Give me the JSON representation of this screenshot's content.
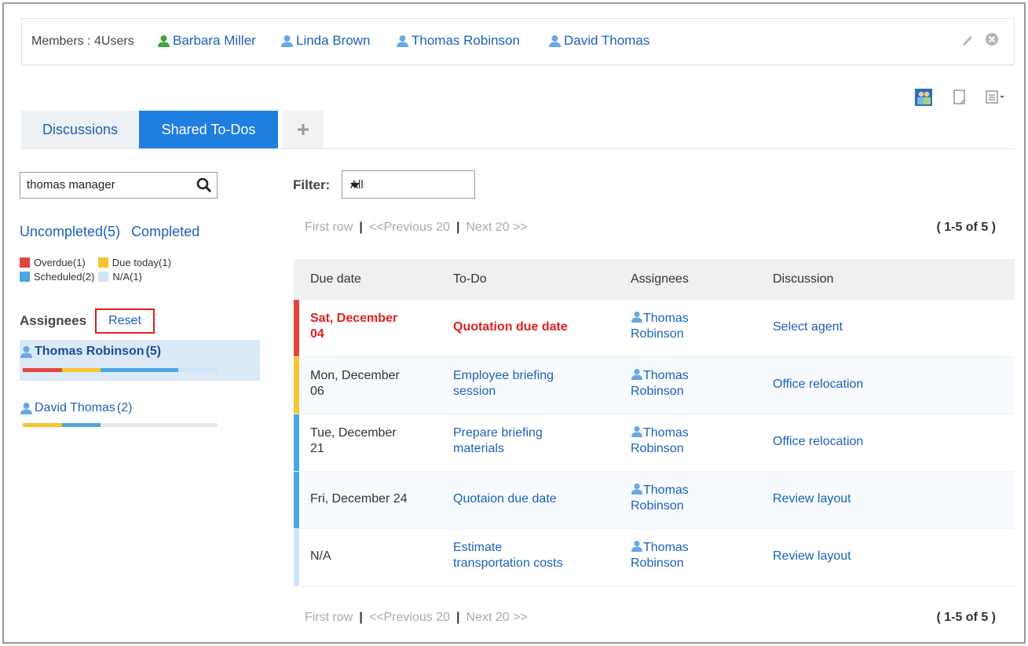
{
  "members": {
    "label": "Members : 4Users",
    "users": [
      "Barbara Miller",
      "Linda Brown",
      "Thomas Robinson",
      "David Thomas"
    ]
  },
  "icons": {
    "edit": "pencil-icon",
    "close": "close-circle-icon",
    "view_people": "people-view-icon",
    "view_page": "page-view-icon",
    "view_list": "list-menu-icon",
    "search": "search-icon",
    "add": "plus-icon",
    "user": "user-icon"
  },
  "tabs": [
    {
      "label": "Discussions"
    },
    {
      "label": "Shared To-Dos"
    }
  ],
  "search": {
    "value": "thomas manager"
  },
  "status_links": {
    "uncompleted": "Uncompleted(5)",
    "completed": "Completed"
  },
  "legend": {
    "overdue": "Overdue(1)",
    "due_today": "Due today(1)",
    "scheduled": "Scheduled(2)",
    "na": "N/A(1)"
  },
  "colors": {
    "overdue": "#e0463d",
    "due_today": "#f6c52f",
    "scheduled": "#4ba6e3",
    "na": "#cde6f8",
    "link": "#1a63b8",
    "tab_active": "#1f7fe0"
  },
  "assignees": {
    "heading": "Assignees",
    "reset": "Reset",
    "items": [
      {
        "name": "Thomas Robinson",
        "count": "(5)",
        "overdue": 1,
        "due_today": 1,
        "scheduled": 2,
        "na": 1
      },
      {
        "name": "David Thomas",
        "count": "(2)",
        "overdue": 0,
        "due_today": 1,
        "scheduled": 1,
        "na": 0
      }
    ]
  },
  "filter": {
    "label": "Filter:",
    "value": "All"
  },
  "pager": {
    "first": "First row",
    "prev": "<<Previous 20",
    "next": "Next 20 >>",
    "count": "( 1-5 of 5 )"
  },
  "table": {
    "headers": {
      "due": "Due date",
      "todo": "To-Do",
      "assignees": "Assignees",
      "discussion": "Discussion"
    },
    "rows": [
      {
        "status": "overdue",
        "due_line1": "Sat, December",
        "due_line2": "04",
        "todo_line1": "Quotation due date",
        "todo_line2": "",
        "assignee_first": "Thomas",
        "assignee_last": "Robinson",
        "discussion": "Select agent"
      },
      {
        "status": "due_today",
        "due_line1": "Mon, December",
        "due_line2": "06",
        "todo_line1": "Employee briefing",
        "todo_line2": "session",
        "assignee_first": "Thomas",
        "assignee_last": "Robinson",
        "discussion": "Office relocation"
      },
      {
        "status": "scheduled",
        "due_line1": "Tue, December",
        "due_line2": "21",
        "todo_line1": "Prepare briefing",
        "todo_line2": "materials",
        "assignee_first": "Thomas",
        "assignee_last": "Robinson",
        "discussion": "Office relocation"
      },
      {
        "status": "scheduled",
        "due_line1": "Fri, December 24",
        "due_line2": "",
        "todo_line1": "Quotaion due date",
        "todo_line2": "",
        "assignee_first": "Thomas",
        "assignee_last": "Robinson",
        "discussion": "Review layout"
      },
      {
        "status": "na",
        "due_line1": "N/A",
        "due_line2": "",
        "todo_line1": "Estimate",
        "todo_line2": "transportation costs",
        "assignee_first": "Thomas",
        "assignee_last": "Robinson",
        "discussion": "Review layout"
      }
    ]
  }
}
